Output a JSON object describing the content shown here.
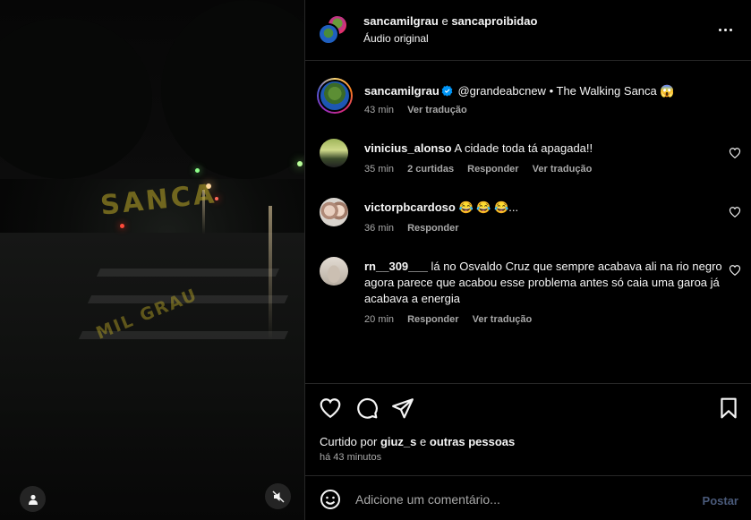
{
  "header": {
    "user1": "sancamilgrau",
    "conjunction": "e",
    "user2": "sancaproibidao",
    "audio": "Áudio original"
  },
  "caption": {
    "username": "sancamilgrau",
    "mention": "@grandeabcnew",
    "separator": "•",
    "text": "The Walking Sanca",
    "emoji": "😱",
    "time": "43 min",
    "see_translation": "Ver tradução"
  },
  "comments": [
    {
      "username": "vinicius_alonso",
      "text": "A cidade toda tá apagada!!",
      "time": "35 min",
      "likes": "2 curtidas",
      "reply": "Responder",
      "translation": "Ver tradução"
    },
    {
      "username": "victorpbcardoso",
      "text": "😂 😂 😂...",
      "time": "36 min",
      "reply": "Responder"
    },
    {
      "username": "rn__309___",
      "text": "lá no Osvaldo Cruz que sempre acabava ali na rio negro agora parece que acabou esse problema antes só caia uma garoa já acabava a energia",
      "time": "20 min",
      "reply": "Responder",
      "translation": "Ver tradução"
    }
  ],
  "video": {
    "watermark_top": "SANCA",
    "watermark_bottom": "MIL GRAU"
  },
  "likes": {
    "prefix": "Curtido por",
    "user": "giuz_s",
    "conjunction": "e",
    "others": "outras pessoas",
    "time": "há 43 minutos"
  },
  "composer": {
    "placeholder": "Adicione um comentário...",
    "post_label": "Postar"
  },
  "icons": {
    "more": "more-options-icon",
    "verified": "verified-badge-icon",
    "like": "heart-icon",
    "comment": "comment-icon",
    "share": "share-icon",
    "save": "bookmark-icon",
    "emoji": "emoji-icon",
    "mute": "speaker-muted-icon",
    "tagged": "user-tag-icon"
  },
  "colors": {
    "background": "#000000",
    "text": "#f5f5f5",
    "muted": "#a8a8a8",
    "verified": "#0095f6",
    "post_disabled": "#4a5a7a"
  }
}
